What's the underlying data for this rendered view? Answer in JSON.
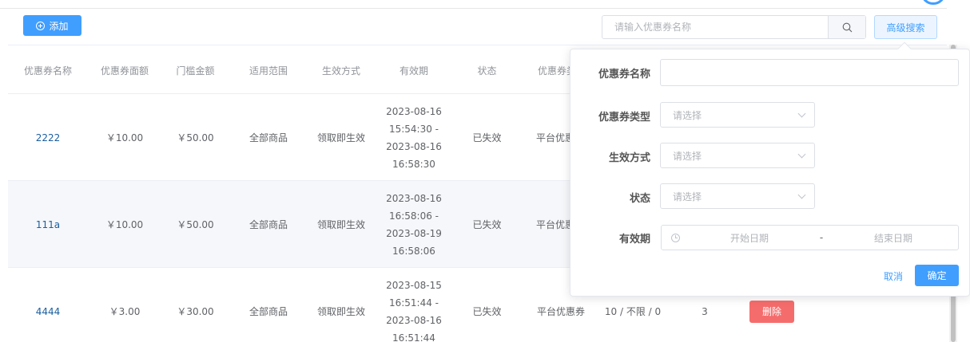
{
  "toolbar": {
    "add_label": "添加",
    "search_placeholder": "请输入优惠券名称",
    "advanced_search_label": "高级搜索"
  },
  "table": {
    "columns": [
      "优惠券名称",
      "优惠券面额",
      "门槛金额",
      "适用范围",
      "生效方式",
      "有效期",
      "状态",
      "优惠券类"
    ],
    "rows": [
      {
        "name": "2222",
        "amount": "￥10.00",
        "threshold": "￥50.00",
        "scope": "全部商品",
        "effect": "领取即生效",
        "validity": "2023-08-16 15:54:30 - 2023-08-16 16:58:30",
        "status": "已失效",
        "type": "平台优惠"
      },
      {
        "name": "111a",
        "amount": "￥10.00",
        "threshold": "￥50.00",
        "scope": "全部商品",
        "effect": "领取即生效",
        "validity": "2023-08-16 16:58:06 - 2023-08-19 16:58:06",
        "status": "已失效",
        "type": "平台优惠"
      },
      {
        "name": "4444",
        "amount": "￥3.00",
        "threshold": "￥30.00",
        "scope": "全部商品",
        "effect": "领取即生效",
        "validity": "2023-08-15 16:51:44 - 2023-08-16 16:51:44",
        "status": "已失效",
        "type": "平台优惠券",
        "quota": "10 / 不限 / 0",
        "count": "3",
        "delete_label": "删除"
      }
    ]
  },
  "advanced_search": {
    "name_label": "优惠券名称",
    "type_label": "优惠券类型",
    "effect_label": "生效方式",
    "status_label": "状态",
    "validity_label": "有效期",
    "select_placeholder": "请选择",
    "date_start_placeholder": "开始日期",
    "date_separator": "-",
    "date_end_placeholder": "结束日期",
    "cancel_label": "取消",
    "confirm_label": "确定"
  },
  "colors": {
    "primary": "#409eff",
    "danger": "#f56c6c",
    "link": "#1a5fa0"
  }
}
